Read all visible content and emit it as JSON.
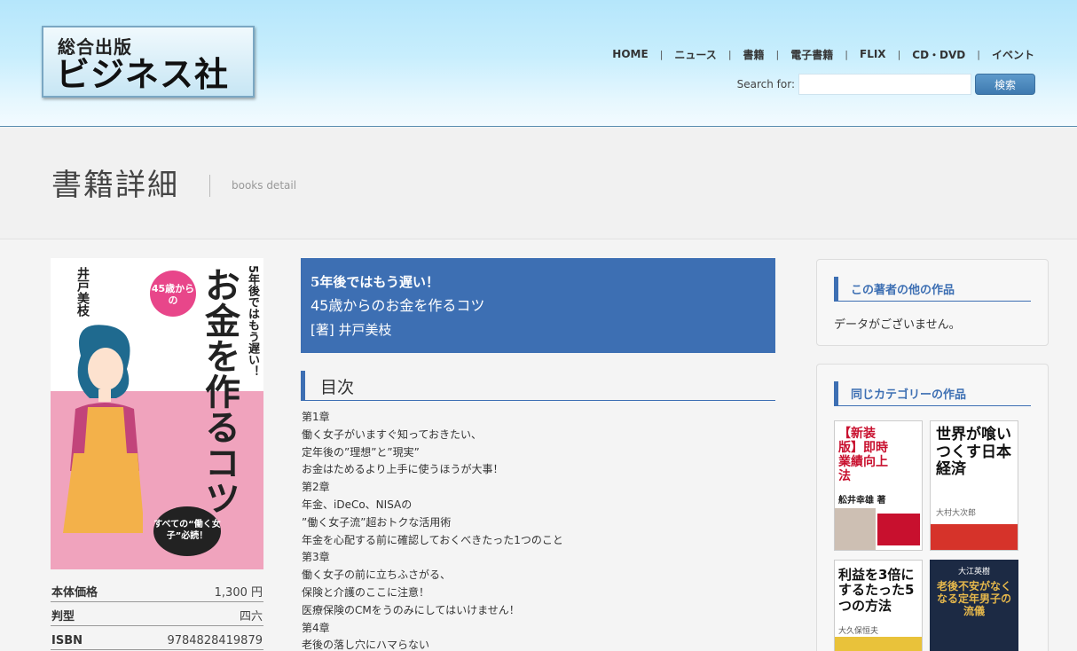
{
  "header": {
    "logo_small": "総合出版",
    "logo_big": "ビジネス社",
    "nav": [
      "HOME",
      "ニュース",
      "書籍",
      "電子書籍",
      "FLIX",
      "CD・DVD",
      "イベント"
    ],
    "search_label": "Search for:",
    "search_value": "",
    "search_button": "検索"
  },
  "title_band": {
    "title": "書籍詳細",
    "subtitle": "books detail"
  },
  "cover": {
    "badge": "45歳からの",
    "title": "お金を作るコツ",
    "subtitle": "5年後ではもう遅い！",
    "author": "井戸美枝",
    "tag": "すべての“働く女子”必読！"
  },
  "specs": [
    {
      "label": "本体価格",
      "value": "1,300 円"
    },
    {
      "label": "判型",
      "value": "四六"
    },
    {
      "label": "ISBN",
      "value": "9784828419879"
    }
  ],
  "book": {
    "subtitle": "5年後ではもう遅い！",
    "title": "45歳からのお金を作るコツ",
    "author": "[著] 井戸美枝"
  },
  "toc": {
    "heading": "目次",
    "lines": [
      "第1章",
      "働く女子がいますぐ知っておきたい、",
      "定年後の”理想”と”現実”",
      "お金はためるより上手に使うほうが大事！",
      "第2章",
      "年金、iDeCo、NISAの",
      "”働く女子流”超おトクな活用術",
      "年金を心配する前に確認しておくべきたった1つのこと",
      "第3章",
      "働く女子の前に立ちふさがる、",
      "保険と介護のここに注意！",
      "医療保険のCMをうのみにしてはいけません！",
      "第4章",
      "老後の落し穴にハマらない"
    ]
  },
  "panels": {
    "author_works": {
      "title": "この著者の他の作品",
      "empty": "データがございません。"
    },
    "category_works": {
      "title": "同じカテゴリーの作品"
    }
  },
  "related_books": [
    {
      "label": "【新装版】即時業績向上法",
      "author": "舩井幸雄 著"
    },
    {
      "label": "世界が喰いつくす日本経済",
      "author": "大村大次郎"
    },
    {
      "label": "利益を3倍にするたった5つの方法",
      "author": "大久保恒夫"
    },
    {
      "label": "老後不安がなくなる定年男子の流儀",
      "author": "大江英樹"
    }
  ],
  "colors": {
    "accent": "#3d6fb3",
    "header_sky": "#b5e6fb"
  }
}
